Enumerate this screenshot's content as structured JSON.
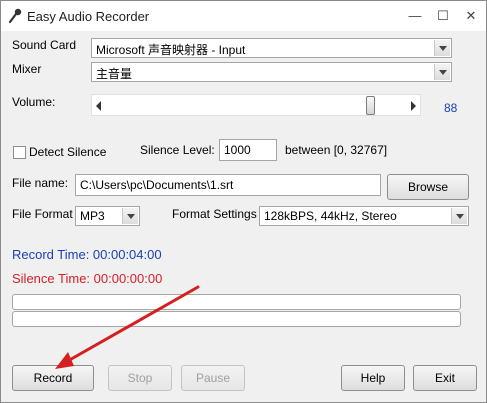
{
  "window": {
    "title": "Easy Audio Recorder",
    "minimize_glyph": "—",
    "maximize_glyph": "☐",
    "close_glyph": "✕"
  },
  "sound_card": {
    "label": "Sound Card",
    "value": "Microsoft 声音映射器 - Input"
  },
  "mixer": {
    "label": "Mixer",
    "value": "主音量"
  },
  "volume": {
    "label": "Volume:",
    "value": "88",
    "level_fraction": 0.88
  },
  "detect_silence": {
    "label": "Detect Silence",
    "checked": false
  },
  "silence_level": {
    "label": "Silence Level:",
    "value": "1000",
    "range_text": "between [0, 32767]"
  },
  "file_name": {
    "label": "File name:",
    "value": "C:\\Users\\pc\\Documents\\1.srt",
    "browse_label": "Browse"
  },
  "file_format": {
    "label": "File Format",
    "value": "MP3"
  },
  "format_settings": {
    "label": "Format Settings",
    "value": "128kBPS, 44kHz, Stereo"
  },
  "record_time": {
    "text": "Record Time:  00:00:04:00",
    "color": "#1a3fb5"
  },
  "silence_time": {
    "text": "Silence Time:  00:00:00:00",
    "color": "#d4202a"
  },
  "buttons": {
    "record": "Record",
    "stop": "Stop",
    "pause": "Pause",
    "help": "Help",
    "exit": "Exit"
  },
  "annotation_color": "#d42020",
  "icons": {
    "app": "microphone-icon",
    "dropdown": "chevron-down-icon",
    "slider_left": "arrow-left-icon",
    "slider_right": "arrow-right-icon"
  }
}
